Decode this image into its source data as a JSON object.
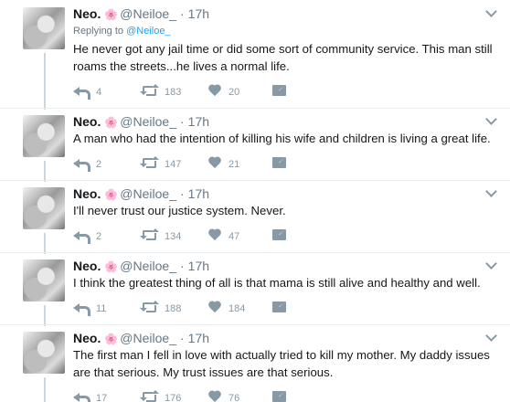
{
  "author": {
    "name": "Neo.",
    "emoji": "🌸",
    "handle": "@Neiloe_",
    "dot": "·"
  },
  "reply_to": {
    "label": "Replying to",
    "mention": "@Neiloe_"
  },
  "tweets": [
    {
      "time": "17h",
      "text": "He never got any jail time or did some sort of community service. This man still roams the streets...he lives a normal life.",
      "replies": "4",
      "retweets": "183",
      "likes": "20"
    },
    {
      "time": "17h",
      "text": "A man who had the intention of killing his wife and children is living a great life.",
      "replies": "2",
      "retweets": "147",
      "likes": "21"
    },
    {
      "time": "17h",
      "text": "I'll never trust our justice system. Never.",
      "replies": "2",
      "retweets": "134",
      "likes": "47"
    },
    {
      "time": "17h",
      "text": "I think the greatest thing of all is that mama is still alive and healthy and well.",
      "replies": "11",
      "retweets": "188",
      "likes": "184"
    },
    {
      "time": "17h",
      "text": "The first man I fell in love with actually tried to kill my mother. My daddy issues are that serious. My trust issues are that serious.",
      "replies": "17",
      "retweets": "176",
      "likes": "76"
    }
  ],
  "icons": {
    "reply": "reply-icon",
    "retweet": "retweet-icon",
    "like": "heart-icon",
    "dm": "envelope-icon",
    "more": "chevron-down-icon"
  },
  "colors": {
    "text": "#14171a",
    "secondary": "#657786",
    "icon": "#8899a6",
    "link": "#1da1f2",
    "thread_line": "#ccd6dd",
    "separator": "#e6ecf0"
  }
}
